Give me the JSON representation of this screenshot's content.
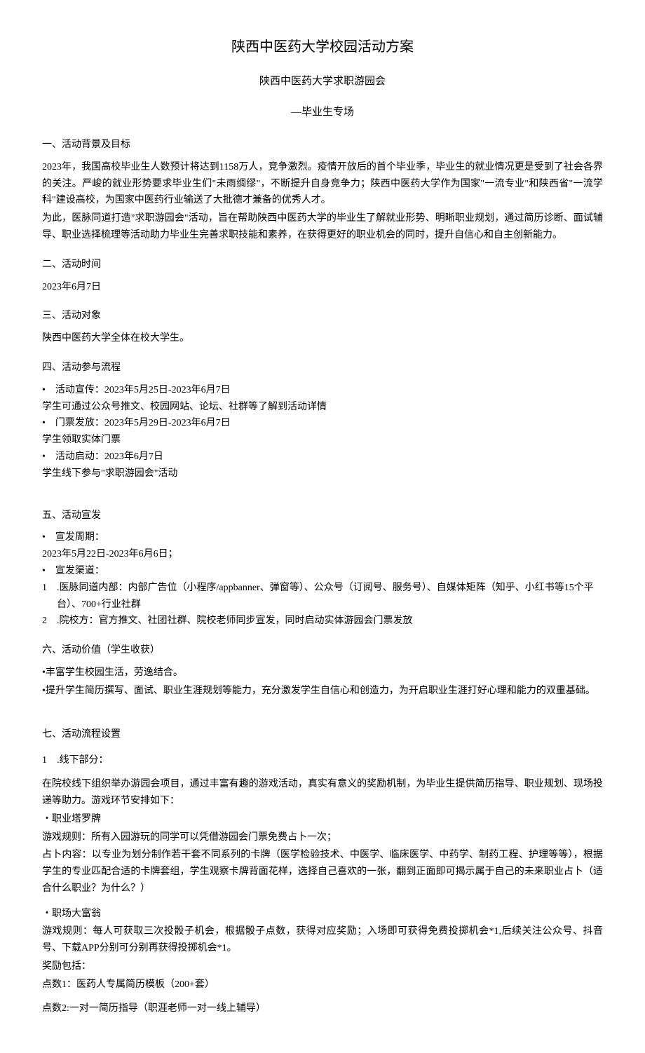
{
  "title_main": "陕西中医药大学校园活动方案",
  "title_sub": "陕西中医药大学求职游园会",
  "title_sub2": "—毕业生专场",
  "s1": {
    "heading": "一、活动背景及目标",
    "p1": "2023年，我国高校毕业生人数预计将达到1158万人，竞争激烈。疫情开放后的首个毕业季，毕业生的就业情况更是受到了社会各界的关注。严峻的就业形势要求毕业生们\"未雨绸缪\"，不断提升自身竞争力；陕西中医药大学作为国家\"一流专业\"和陕西省\"一流学科\"建设高校，为国家中医药行业输送了大批德才兼备的优秀人才。",
    "p2": "为此，医脉同道打造\"求职游园会\"活动，旨在帮助陕西中医药大学的毕业生了解就业形势、明晰职业规划，通过简历诊断、面试辅导、职业选择梳理等活动助力毕业生完善求职技能和素养，在获得更好的职业机会的同时，提升自信心和自主创新能力。"
  },
  "s2": {
    "heading": "二、活动时间",
    "p1": "2023年6月7日"
  },
  "s3": {
    "heading": "三、活动对象",
    "p1": "陕西中医药大学全体在校大学生。"
  },
  "s4": {
    "heading": "四、活动参与流程",
    "b1": "•　活动宣传：2023年5月25日-2023年6月7日",
    "b1d": "学生可通过公众号推文、校园网站、论坛、社群等了解到活动详情",
    "b2": "•　门票发放：2023年5月29日-2023年6月7日",
    "b2d": "学生领取实体门票",
    "b3": "•　活动启动：2023年6月7日",
    "b3d": "学生线下参与\"求职游园会\"活动"
  },
  "s5": {
    "heading": "五、活动宣发",
    "b1": "•　宣发周期：",
    "b1d": "2023年5月22日-2023年6月6日；",
    "b2": "•　宣发渠道：",
    "n1": "1　.医脉同道内部：内部广告位（小程序/appbanner、弹窗等）、公众号（订阅号、服务号）、自媒体矩阵（知乎、小红书等15个平台）、700+行业社群",
    "n2": "2　.院校方：官方推文、社团社群、院校老师同步宣发，同时启动实体游园会门票发放"
  },
  "s6": {
    "heading": "六、活动价值（学生收获）",
    "p1": "•丰富学生校园生活，劳逸结合。",
    "p2": "•提升学生简历撰写、面试、职业生涯规划等能力，充分激发学生自信心和创造力，为开启职业生涯打好心理和能力的双重基础。"
  },
  "s7": {
    "heading": "七、活动流程设置",
    "sub1": "1　.线下部分：",
    "p1": "在院校线下组织举办游园会项目，通过丰富有趣的游戏活动，真实有意义的奖励机制，为毕业生提供简历指导、职业规划、现场投递等助力。游戏环节安排如下：",
    "g1_title": "・职业塔罗牌",
    "g1_rule": "游戏规则：所有入园游玩的同学可以凭借游园会门票免费占卜一次；",
    "g1_content": "占卜内容：以专业为划分制作若干套不同系列的卡牌（医学检验技术、中医学、临床医学、中药学、制药工程、护理等等），根据学生的专业匹配合适的卡牌套组，学生观察卡牌背面花样，选择自己喜欢的一张，翻到正面即可揭示属于自己的未来职业占卜（适合什么职业？为什么？）",
    "g2_title": "・职场大富翁",
    "g2_rule": "游戏规则：每人可获取三次投骰子机会，根据骰子点数，获得对应奖励；入场即可获得免费投掷机会*1,后续关注公众号、抖音号、下载APP分别可分别再获得投掷机会*1。",
    "g2_reward_label": "奖励包括：",
    "g2_r1": "点数1：医药人专属简历模板（200+套）",
    "g2_r2": "点数2:一对一简历指导（职涯老师一对一线上辅导）"
  }
}
